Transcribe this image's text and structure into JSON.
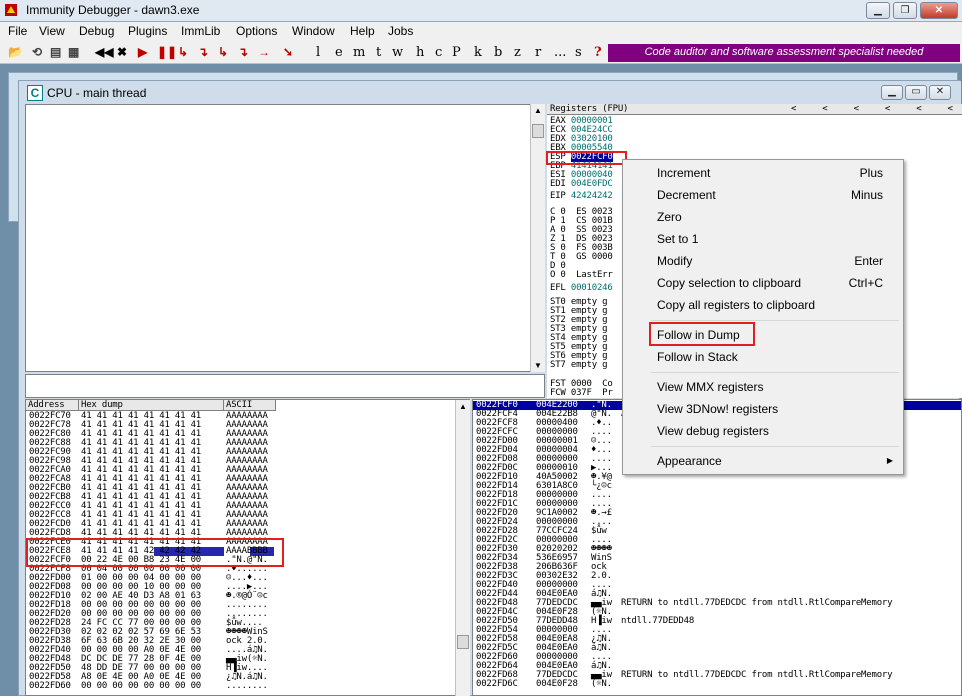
{
  "app": {
    "title": "Immunity Debugger - dawn3.exe"
  },
  "menu": [
    "File",
    "View",
    "Debug",
    "Plugins",
    "ImmLib",
    "Options",
    "Window",
    "Help",
    "Jobs"
  ],
  "toolbar": {
    "letters": [
      "l",
      "e",
      "m",
      "t",
      "w",
      "h",
      "c",
      "P",
      "k",
      "b",
      "z",
      "r",
      "...",
      "s",
      "?"
    ],
    "banner": "Code auditor and software assessment specialist needed"
  },
  "cpu": {
    "title": "CPU - main thread"
  },
  "registers": {
    "header": "Registers (FPU)",
    "arrows": "<     <     <     <     <     <",
    "gp": [
      [
        "EAX",
        "00000001"
      ],
      [
        "ECX",
        "004E24CC"
      ],
      [
        "EDX",
        "03020100"
      ],
      [
        "EBX",
        "00005540"
      ],
      [
        "ESP",
        "0022FCF0"
      ],
      [
        "EBP",
        "41414141"
      ],
      [
        "ESI",
        "00000040"
      ],
      [
        "EDI",
        "004E0FDC"
      ]
    ],
    "eip": [
      "EIP",
      "42424242"
    ],
    "flags": [
      "C 0  ES 0023",
      "P 1  CS 001B",
      "A 0  SS 0023",
      "Z 1  DS 0023",
      "S 0  FS 003B",
      "T 0  GS 0000",
      "D 0",
      "O 0  LastErr"
    ],
    "efl": [
      "EFL",
      "00010246"
    ],
    "fpu": [
      "ST0 empty g",
      "ST1 empty g",
      "ST2 empty g",
      "ST3 empty g",
      "ST4 empty g",
      "ST5 empty g",
      "ST6 empty g",
      "ST7 empty g"
    ],
    "fst": "FST 0000  Co",
    "fcw": "FCW 037F  Pr"
  },
  "dump": {
    "headers": [
      "Address",
      "Hex dump",
      "ASCII"
    ],
    "rows": [
      [
        "0022FC70",
        "41 41 41 41 41 41 41 41",
        "AAAAAAAA"
      ],
      [
        "0022FC78",
        "41 41 41 41 41 41 41 41",
        "AAAAAAAA"
      ],
      [
        "0022FC80",
        "41 41 41 41 41 41 41 41",
        "AAAAAAAA"
      ],
      [
        "0022FC88",
        "41 41 41 41 41 41 41 41",
        "AAAAAAAA"
      ],
      [
        "0022FC90",
        "41 41 41 41 41 41 41 41",
        "AAAAAAAA"
      ],
      [
        "0022FC98",
        "41 41 41 41 41 41 41 41",
        "AAAAAAAA"
      ],
      [
        "0022FCA0",
        "41 41 41 41 41 41 41 41",
        "AAAAAAAA"
      ],
      [
        "0022FCA8",
        "41 41 41 41 41 41 41 41",
        "AAAAAAAA"
      ],
      [
        "0022FCB0",
        "41 41 41 41 41 41 41 41",
        "AAAAAAAA"
      ],
      [
        "0022FCB8",
        "41 41 41 41 41 41 41 41",
        "AAAAAAAA"
      ],
      [
        "0022FCC0",
        "41 41 41 41 41 41 41 41",
        "AAAAAAAA"
      ],
      [
        "0022FCC8",
        "41 41 41 41 41 41 41 41",
        "AAAAAAAA"
      ],
      [
        "0022FCD0",
        "41 41 41 41 41 41 41 41",
        "AAAAAAAA"
      ],
      [
        "0022FCD8",
        "41 41 41 41 41 41 41 41",
        "AAAAAAAA"
      ],
      [
        "0022FCE0",
        "41 41 41 41 41 41 41 41",
        "AAAAAAAA"
      ],
      [
        "0022FCE8",
        "41 41 41 41 42 42 42 42",
        "AAAABBBB"
      ],
      [
        "0022FCF0",
        "00 22 4E 00 B8 23 4E 00",
        ".\"N.@\"N."
      ],
      [
        "0022FCF8",
        "00 04 00 00 00 00 00 00",
        ".♦......"
      ],
      [
        "0022FD00",
        "01 00 00 00 04 00 00 00",
        "☺...♦..."
      ],
      [
        "0022FD08",
        "00 00 00 00 10 00 00 00",
        "....▶..."
      ],
      [
        "0022FD10",
        "02 00 AE 40 D3 A8 01 63",
        "☻.®@Ó¨☺c"
      ],
      [
        "0022FD18",
        "00 00 00 00 00 00 00 00",
        "........"
      ],
      [
        "0022FD20",
        "00 00 00 00 00 00 00 00",
        "........"
      ],
      [
        "0022FD28",
        "24 FC CC 77 00 00 00 00",
        "$ǚw...."
      ],
      [
        "0022FD30",
        "02 02 02 02 57 69 6E 53",
        "☻☻☻☻WinS"
      ],
      [
        "0022FD38",
        "6F 63 6B 20 32 2E 30 00",
        "ock 2.0."
      ],
      [
        "0022FD40",
        "00 00 00 00 A0 0E 4E 00",
        "....á♫N."
      ],
      [
        "0022FD48",
        "DC DC DE 77 28 0F 4E 00",
        "▄▄iw(☼N."
      ],
      [
        "0022FD50",
        "48 DD DE 77 00 00 00 00",
        "H▐iw...."
      ],
      [
        "0022FD58",
        "A8 0E 4E 00 A0 0E 4E 00",
        "¿♫N.á♫N."
      ],
      [
        "0022FD60",
        "00 00 00 00 00 00 00 00",
        "........"
      ]
    ]
  },
  "stack": {
    "rows": [
      [
        "0022FCF0",
        "004E2200",
        ".\"N.",
        ""
      ],
      [
        "0022FCF4",
        "004E22B8",
        "@\"N.",
        "AAAAAAAAAAAAAAAA"
      ],
      [
        "0022FCF8",
        "00000400",
        ".♦..",
        ""
      ],
      [
        "0022FCFC",
        "00000000",
        "....",
        ""
      ],
      [
        "0022FD00",
        "00000001",
        "☺...",
        ""
      ],
      [
        "0022FD04",
        "00000004",
        "♦...",
        ""
      ],
      [
        "0022FD08",
        "00000000",
        "....",
        ""
      ],
      [
        "0022FD0C",
        "00000010",
        "▶...",
        ""
      ],
      [
        "0022FD10",
        "40A50002",
        "☻.¥@",
        ""
      ],
      [
        "0022FD14",
        "6301A8C0",
        "└¿☺c",
        ""
      ],
      [
        "0022FD18",
        "00000000",
        "....",
        ""
      ],
      [
        "0022FD1C",
        "00000000",
        "....",
        ""
      ],
      [
        "0022FD20",
        "9C1A0002",
        "☻.→£",
        ""
      ],
      [
        "0022FD24",
        "00000000",
        "....",
        ""
      ],
      [
        "0022FD28",
        "77CCFC24",
        "$ǚw",
        ""
      ],
      [
        "0022FD2C",
        "00000000",
        "....",
        ""
      ],
      [
        "0022FD30",
        "02020202",
        "☻☻☻☻",
        ""
      ],
      [
        "0022FD34",
        "536E6957",
        "WinS",
        ""
      ],
      [
        "0022FD38",
        "206B636F",
        "ock ",
        ""
      ],
      [
        "0022FD3C",
        "00302E32",
        "2.0.",
        ""
      ],
      [
        "0022FD40",
        "00000000",
        "....",
        ""
      ],
      [
        "0022FD44",
        "004E0EA0",
        "á♫N.",
        ""
      ],
      [
        "0022FD48",
        "77DEDCDC",
        "▄▄iw",
        "RETURN to ntdll.77DEDCDC from ntdll.RtlCompareMemory"
      ],
      [
        "0022FD4C",
        "004E0F28",
        "(☼N.",
        ""
      ],
      [
        "0022FD50",
        "77DEDD48",
        "H▐iw",
        "ntdll.77DEDD48"
      ],
      [
        "0022FD54",
        "00000000",
        "....",
        ""
      ],
      [
        "0022FD58",
        "004E0EA8",
        "¿♫N.",
        ""
      ],
      [
        "0022FD5C",
        "004E0EA0",
        "á♫N.",
        ""
      ],
      [
        "0022FD60",
        "00000000",
        "....",
        ""
      ],
      [
        "0022FD64",
        "004E0EA0",
        "á♫N.",
        ""
      ],
      [
        "0022FD68",
        "77DEDCDC",
        "▄▄iw",
        "RETURN to ntdll.77DEDCDC from ntdll.RtlCompareMemory"
      ],
      [
        "0022FD6C",
        "004E0F28",
        "(☼N.",
        ""
      ]
    ]
  },
  "context_menu": {
    "items": [
      {
        "label": "Increment",
        "shortcut": "Plus"
      },
      {
        "label": "Decrement",
        "shortcut": "Minus"
      },
      {
        "label": "Zero",
        "shortcut": ""
      },
      {
        "label": "Set to 1",
        "shortcut": ""
      },
      {
        "label": "Modify",
        "shortcut": "Enter"
      },
      {
        "label": "Copy selection to clipboard",
        "shortcut": "Ctrl+C"
      },
      {
        "label": "Copy all registers to clipboard",
        "shortcut": ""
      },
      {
        "label": "Follow in Dump",
        "shortcut": ""
      },
      {
        "label": "Follow in Stack",
        "shortcut": ""
      },
      {
        "label": "View MMX registers",
        "shortcut": ""
      },
      {
        "label": "View 3DNow! registers",
        "shortcut": ""
      },
      {
        "label": "View debug registers",
        "shortcut": ""
      },
      {
        "label": "Appearance",
        "shortcut": ""
      }
    ]
  }
}
